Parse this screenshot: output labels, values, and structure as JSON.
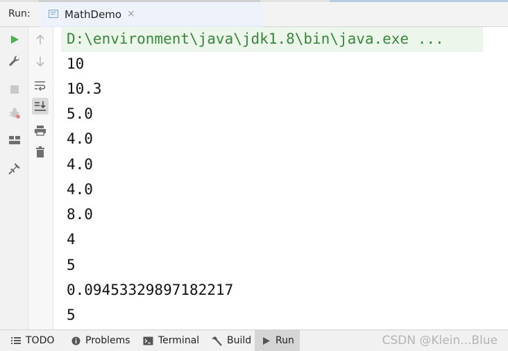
{
  "header": {
    "panel_label": "Run:",
    "tab_title": "MathDemo",
    "tab_close": "×"
  },
  "console": {
    "command": "D:\\environment\\java\\jdk1.8\\bin\\java.exe ...",
    "output": [
      "10",
      "10.3",
      "5.0",
      "4.0",
      "4.0",
      "4.0",
      "8.0",
      "4",
      "5",
      "0.09453329897182217",
      "5"
    ]
  },
  "bottom_bar": {
    "items": [
      {
        "label": "TODO",
        "icon": "list-icon"
      },
      {
        "label": "Problems",
        "icon": "info-circle-icon"
      },
      {
        "label": "Terminal",
        "icon": "terminal-icon"
      },
      {
        "label": "Build",
        "icon": "hammer-icon"
      },
      {
        "label": "Run",
        "icon": "play-icon",
        "active": true
      }
    ],
    "watermark": "CSDN @Klein...Blue"
  },
  "colors": {
    "run_green": "#4caf50",
    "command_text": "#39863d",
    "command_background": "#edf6ea"
  },
  "left_toolbar": {
    "icons": [
      "run-icon",
      "wrench-icon",
      "stop-icon",
      "debug-icon",
      "layout-icon",
      "pin-icon"
    ]
  },
  "console_toolbar": {
    "icons": [
      "up-arrow-icon",
      "down-arrow-icon",
      "soft-wrap-icon",
      "scroll-to-end-icon",
      "print-icon",
      "trash-icon"
    ]
  }
}
